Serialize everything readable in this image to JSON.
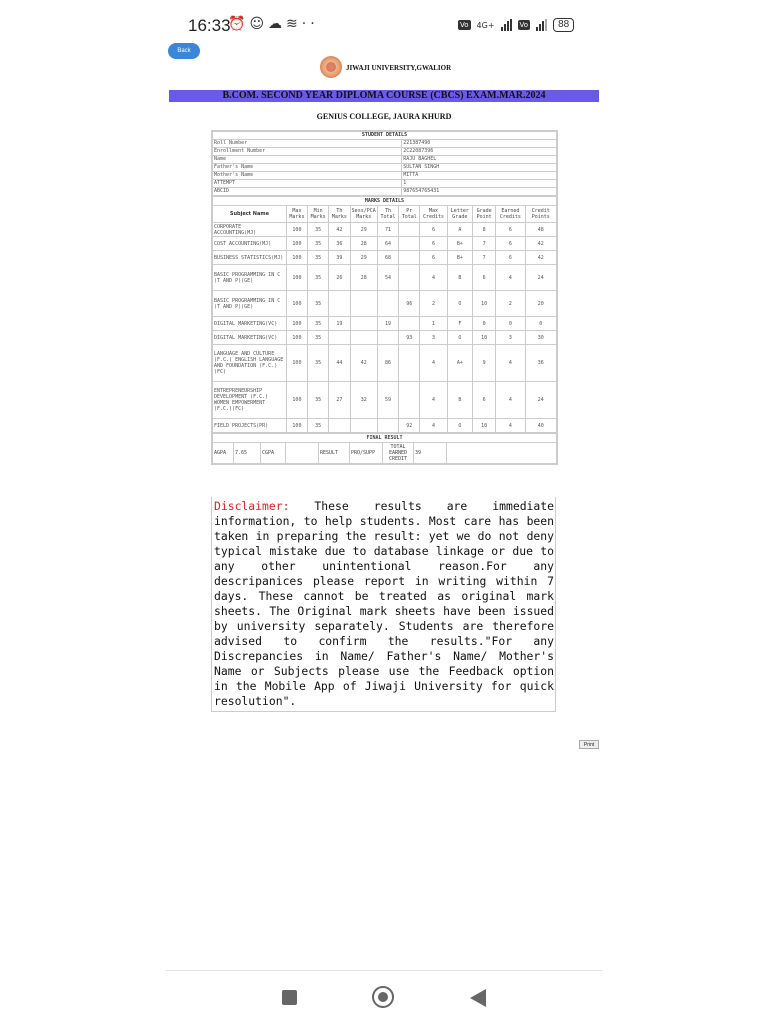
{
  "status_bar": {
    "time": "16:33",
    "left_icons": [
      "alarm-icon",
      "cat-icon",
      "cloud-icon",
      "layers-icon",
      "more-icon"
    ],
    "network": "4G+",
    "battery": "88"
  },
  "page": {
    "back_label": "Back",
    "university": "JIWAJI UNIVERSITY,GWALIOR",
    "course_title": "B.COM. SECOND YEAR DIPLOMA COURSE (CBCS) EXAM.MAR.2024",
    "college": "GENIUS COLLEGE, JAURA KHURD",
    "print_label": "Print"
  },
  "student_details": {
    "title": "STUDENT DETAILS",
    "rows": [
      {
        "label": "Roll Number",
        "value": "221387490"
      },
      {
        "label": "Enrollment Number",
        "value": "2C22087396"
      },
      {
        "label": "Name",
        "value": "RAJU BAGHEL"
      },
      {
        "label": "Father's Name",
        "value": "SULTAN SINGH"
      },
      {
        "label": "Mother's Name",
        "value": "MITTA"
      },
      {
        "label": "ATTEMPT",
        "value": "1"
      },
      {
        "label": "ABCID",
        "value": "987654765431"
      }
    ]
  },
  "marks_details": {
    "title": "MARKS DETAILS",
    "headers": [
      "Subject Name",
      "Max Marks",
      "Min Marks",
      "Th Marks",
      "Sess/PCA Marks",
      "Th Total",
      "Pr Total",
      "Max Credits",
      "Letter Grade",
      "Grade Point",
      "Earned Credits",
      "Credit Points"
    ],
    "rows": [
      {
        "subject": "CORPORATE ACCOUNTING(MJ)",
        "max": "100",
        "min": "35",
        "th": "42",
        "sess": "29",
        "th_total": "71",
        "pr_total": "",
        "max_credits": "6",
        "grade": "A",
        "grade_point": "8",
        "earned": "6",
        "credit_points": "48"
      },
      {
        "subject": "COST ACCOUNTING(MJ)",
        "max": "100",
        "min": "35",
        "th": "36",
        "sess": "28",
        "th_total": "64",
        "pr_total": "",
        "max_credits": "6",
        "grade": "B+",
        "grade_point": "7",
        "earned": "6",
        "credit_points": "42"
      },
      {
        "subject": "BUSINESS STATISTICS(MJ)",
        "max": "100",
        "min": "35",
        "th": "39",
        "sess": "29",
        "th_total": "68",
        "pr_total": "",
        "max_credits": "6",
        "grade": "B+",
        "grade_point": "7",
        "earned": "6",
        "credit_points": "42"
      },
      {
        "subject": "BASIC PROGRAMMING IN C (T AND P)(GE)",
        "max": "100",
        "min": "35",
        "th": "26",
        "sess": "28",
        "th_total": "54",
        "pr_total": "",
        "max_credits": "4",
        "grade": "B",
        "grade_point": "6",
        "earned": "4",
        "credit_points": "24"
      },
      {
        "subject": "BASIC PROGRAMMING IN C (T AND P)(GE)",
        "max": "100",
        "min": "35",
        "th": "",
        "sess": "",
        "th_total": "",
        "pr_total": "96",
        "max_credits": "2",
        "grade": "O",
        "grade_point": "10",
        "earned": "2",
        "credit_points": "20"
      },
      {
        "subject": "DIGITAL MARKETING(VC)",
        "max": "100",
        "min": "35",
        "th": "19",
        "sess": "",
        "th_total": "19",
        "pr_total": "",
        "max_credits": "1",
        "grade": "F",
        "grade_point": "0",
        "earned": "0",
        "credit_points": "0"
      },
      {
        "subject": "DIGITAL MARKETING(VC)",
        "max": "100",
        "min": "35",
        "th": "",
        "sess": "",
        "th_total": "",
        "pr_total": "93",
        "max_credits": "3",
        "grade": "O",
        "grade_point": "10",
        "earned": "3",
        "credit_points": "30"
      },
      {
        "subject": "LANGUAGE AND CULTURE (F.C.) ENGLISH LANGUAGE AND FOUNDATION (F.C.)(FC)",
        "max": "100",
        "min": "35",
        "th": "44",
        "sess": "42",
        "th_total": "86",
        "pr_total": "",
        "max_credits": "4",
        "grade": "A+",
        "grade_point": "9",
        "earned": "4",
        "credit_points": "36"
      },
      {
        "subject": "ENTREPRENEURSHIP DEVELOPMENT (F.C.) WOMEN EMPOWERMENT (F.C.)(FC)",
        "max": "100",
        "min": "35",
        "th": "27",
        "sess": "32",
        "th_total": "59",
        "pr_total": "",
        "max_credits": "4",
        "grade": "B",
        "grade_point": "6",
        "earned": "4",
        "credit_points": "24"
      },
      {
        "subject": "FIELD PROJECTS(PR)",
        "max": "100",
        "min": "35",
        "th": "",
        "sess": "",
        "th_total": "",
        "pr_total": "92",
        "max_credits": "4",
        "grade": "O",
        "grade_point": "10",
        "earned": "4",
        "credit_points": "40"
      }
    ]
  },
  "final_result": {
    "title": "FINAL RESULT",
    "agpa_label": "AGPA",
    "agpa_value": "7.65",
    "cgpa_label": "CGPA",
    "cgpa_value": "",
    "result_label": "RESULT",
    "result_value": "PRO/SUPP",
    "total_credit_label": "TOTAL EARNED CREDIT",
    "total_credit_value": "39"
  },
  "disclaimer": {
    "label": "Disclaimer:",
    "text": " These results are immediate information, to help students. Most care has been taken in preparing the result: yet we do not deny typical mistake due to database linkage or due to any other unintentional reason.For any descripanices please report in writing within 7 days. These cannot be treated as original mark sheets. The Original mark sheets have been issued by university separately. Students are therefore advised to confirm the results.\"For any Discrepancies in Name/ Father's Name/ Mother's Name or Subjects please use the Feedback option in the Mobile App of Jiwaji University for quick resolution\"."
  },
  "colors": {
    "banner": "#6a5ae8",
    "back_button": "#3a86d8",
    "disclaimer_label": "#e02020"
  }
}
